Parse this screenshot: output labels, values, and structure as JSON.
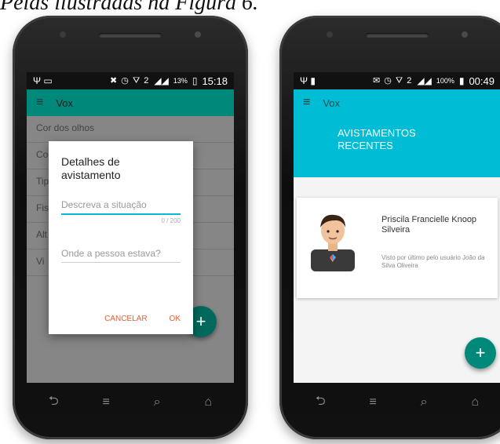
{
  "caption": "Pelas ilustradas na Figura 6.",
  "left_phone": {
    "status": {
      "left_icons": "Ψ ▭",
      "right_icons": "✖ ◷ ⛛ 2",
      "battery": "13%",
      "time": "15:18"
    },
    "appbar": {
      "menu_icon": "hamburger-icon",
      "title": "Vox"
    },
    "form_fields": [
      "Cor dos olhos",
      "Co",
      "Tip",
      "Fis",
      "Alt",
      "Vi"
    ],
    "dialog": {
      "title": "Detalhes de avistamento",
      "description_placeholder": "Descreva a situação",
      "counter": "0 / 200",
      "location_placeholder": "Onde a pessoa estava?",
      "cancel_label": "CANCELAR",
      "ok_label": "OK"
    },
    "fab_label": "+",
    "nav": {
      "back": "⮌",
      "home": "⌂",
      "search": "⌕",
      "menu": "≡"
    }
  },
  "right_phone": {
    "status": {
      "left_icons": "Ψ ▮",
      "right_icons": "✉ ◷ ⛛ 2",
      "battery": "100%",
      "time": "00:49"
    },
    "appbar": {
      "menu_icon": "hamburger-icon",
      "title": "Vox"
    },
    "hero_title": "AVISTAMENTOS RECENTES",
    "card": {
      "name": "Priscila Francielle Knoop Silveira",
      "last_seen": "Visto por último pelo usuário João da Silva Oliveira"
    },
    "fab_label": "+",
    "nav": {
      "back": "⮌",
      "home": "⌂",
      "search": "⌕",
      "menu": "≡"
    }
  },
  "colors": {
    "teal": "#00897b",
    "cyan": "#00bcd4",
    "accent": "#e0633a"
  }
}
